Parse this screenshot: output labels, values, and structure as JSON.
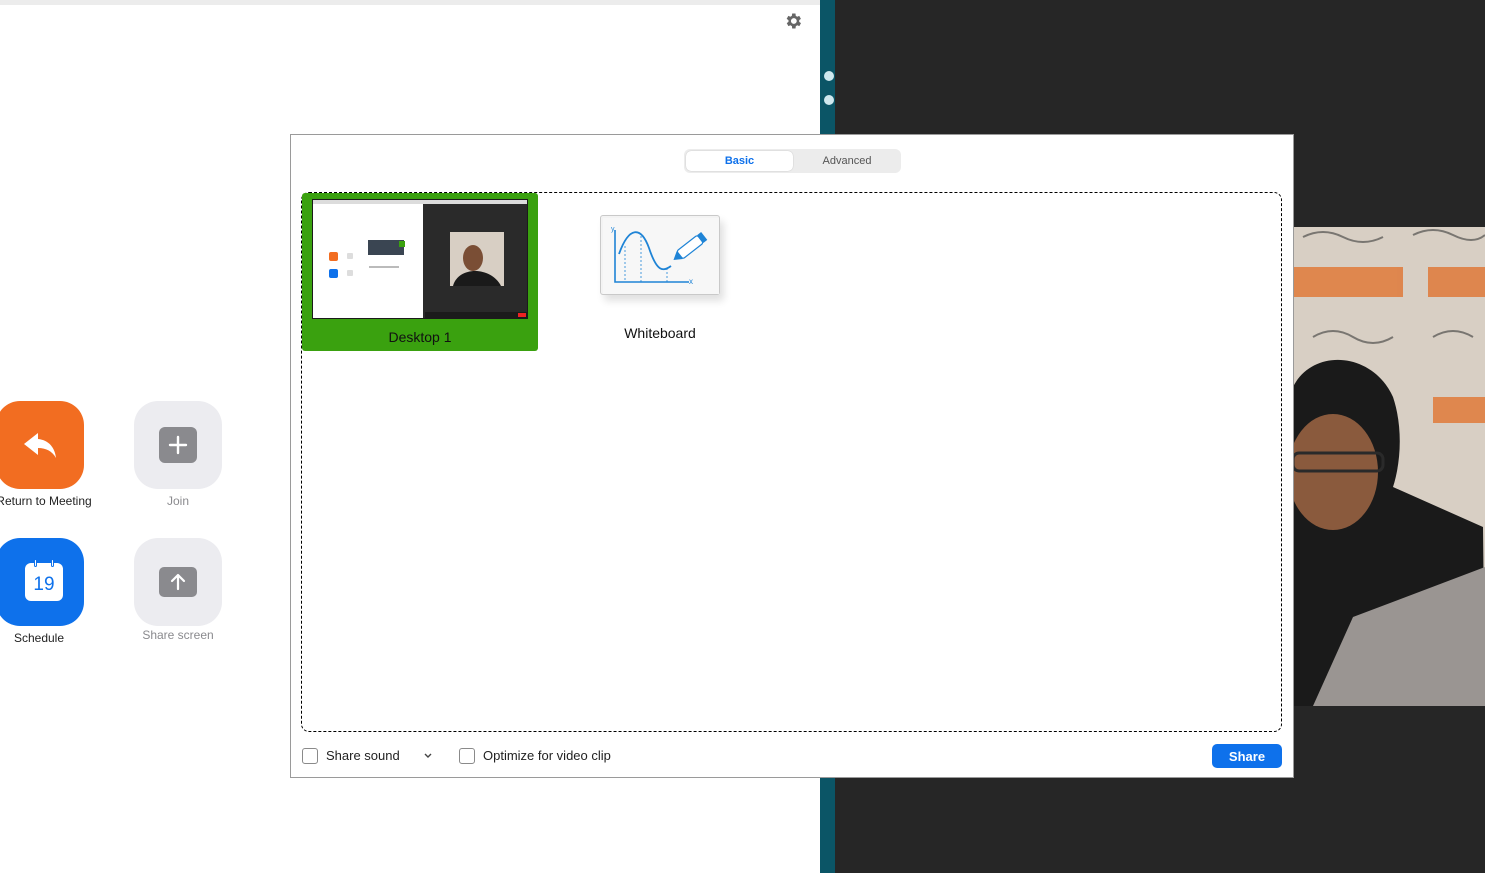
{
  "home": {
    "buttons": {
      "return_label": "Return to Meeting",
      "join_label": "Join",
      "schedule_label": "Schedule",
      "schedule_date": "19",
      "share_screen_label": "Share screen"
    },
    "colors": {
      "return": "#f26d21",
      "schedule": "#0e71eb",
      "disabled": "#ececf0"
    }
  },
  "dialog": {
    "tabs": {
      "basic": "Basic",
      "advanced": "Advanced"
    },
    "selected_tab": "Basic",
    "sources": [
      {
        "label": "Desktop 1",
        "selected": true
      },
      {
        "label": "Whiteboard",
        "selected": false
      }
    ],
    "footer": {
      "share_sound_label": "Share sound",
      "share_sound_checked": false,
      "optimize_label": "Optimize for video clip",
      "optimize_checked": false,
      "share_button": "Share"
    },
    "colors": {
      "accent": "#0e71eb",
      "selection": "#3aa10f"
    }
  },
  "icons": {
    "settings": "gear-icon",
    "return": "reply-arrow-icon",
    "join": "plus-icon",
    "schedule": "calendar-icon",
    "share_screen": "upload-arrow-icon",
    "share_sound_menu": "chevron-down-icon"
  }
}
